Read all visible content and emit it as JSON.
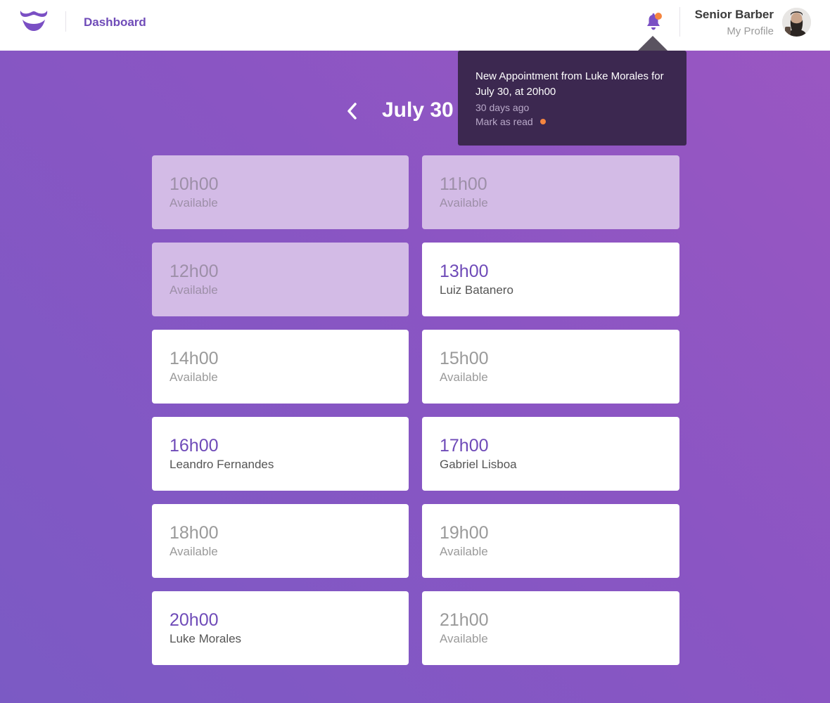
{
  "header": {
    "nav_label": "Dashboard",
    "profile_name": "Senior Barber",
    "profile_link": "My Profile"
  },
  "notification": {
    "message": "New Appointment from Luke Morales for July 30, at 20h00",
    "time_ago": "30 days ago",
    "mark_read_label": "Mark as read",
    "unread_color": "#f5853f"
  },
  "schedule": {
    "date_title": "July 30",
    "slots": [
      {
        "time": "10h00",
        "label": "Available",
        "state": "past"
      },
      {
        "time": "11h00",
        "label": "Available",
        "state": "past"
      },
      {
        "time": "12h00",
        "label": "Available",
        "state": "past"
      },
      {
        "time": "13h00",
        "label": "Luiz Batanero",
        "state": "booked"
      },
      {
        "time": "14h00",
        "label": "Available",
        "state": "open"
      },
      {
        "time": "15h00",
        "label": "Available",
        "state": "open"
      },
      {
        "time": "16h00",
        "label": "Leandro Fernandes",
        "state": "booked"
      },
      {
        "time": "17h00",
        "label": "Gabriel Lisboa",
        "state": "booked"
      },
      {
        "time": "18h00",
        "label": "Available",
        "state": "open"
      },
      {
        "time": "19h00",
        "label": "Available",
        "state": "open"
      },
      {
        "time": "20h00",
        "label": "Luke Morales",
        "state": "booked"
      },
      {
        "time": "21h00",
        "label": "Available",
        "state": "open"
      }
    ]
  },
  "colors": {
    "accent": "#6f4bb8",
    "notification_dot": "#f5853f"
  }
}
